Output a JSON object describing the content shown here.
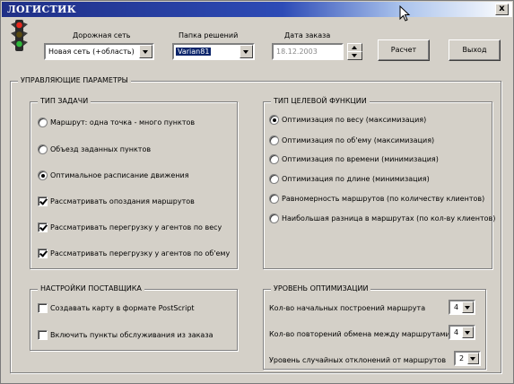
{
  "window": {
    "title": "ЛОГИСТИК",
    "close_label": "x"
  },
  "top": {
    "network": {
      "label": "Дорожная сеть",
      "value": "Новая сеть (+область)"
    },
    "folder": {
      "label": "Папка решений",
      "value": "Varian81"
    },
    "date": {
      "label": "Дата заказа",
      "value": "18.12.2003"
    },
    "calc_label": "Расчет",
    "exit_label": "Выход"
  },
  "params": {
    "title": "УПРАВЛЯЮЩИЕ ПАРАМЕТРЫ",
    "task_type": {
      "title": "ТИП ЗАДАЧИ",
      "options": [
        {
          "label": "Маршрут: одна точка - много пунктов",
          "checked": false
        },
        {
          "label": "Объезд заданных пунктов",
          "checked": false
        },
        {
          "label": "Оптимальное расписание движения",
          "checked": true
        }
      ],
      "checks": [
        {
          "label": "Рассматривать опоздания маршрутов",
          "checked": true
        },
        {
          "label": "Рассматривать перегрузку у агентов по весу",
          "checked": true
        },
        {
          "label": "Рассматривать перегрузку у агентов по об'ему",
          "checked": true
        }
      ]
    },
    "target_function": {
      "title": "ТИП ЦЕЛЕВОЙ ФУНКЦИИ",
      "options": [
        {
          "label": "Оптимизация по весу (максимизация)",
          "checked": true
        },
        {
          "label": "Оптимизация по об'ему (максимизация)",
          "checked": false
        },
        {
          "label": "Оптимизация по времени (минимизация)",
          "checked": false
        },
        {
          "label": "Оптимизация по длине (минимизация)",
          "checked": false
        },
        {
          "label": "Равномерность маршрутов (по количеству клиентов)",
          "checked": false
        },
        {
          "label": "Наибольшая разница в маршрутах (по кол-ву клиентов)",
          "checked": false
        }
      ]
    },
    "supplier": {
      "title": "НАСТРОЙКИ ПОСТАВЩИКА",
      "checks": [
        {
          "label": "Создавать карту в формате PostScript",
          "checked": false
        },
        {
          "label": "Включить пункты обслуживания из заказа",
          "checked": false
        }
      ]
    },
    "optimization": {
      "title": "УРОВЕНЬ ОПТИМИЗАЦИИ",
      "rows": [
        {
          "label": "Кол-во начальных построений маршрута",
          "value": "4"
        },
        {
          "label": "Кол-во повторений обмена между маршрутами",
          "value": "4"
        },
        {
          "label": "Уровень случайных отклонений от  маршрутов",
          "value": "2"
        }
      ]
    }
  },
  "colors": {
    "titlebar_start": "#1f2f86",
    "face": "#d4d0c8",
    "selection": "#0a246a"
  }
}
